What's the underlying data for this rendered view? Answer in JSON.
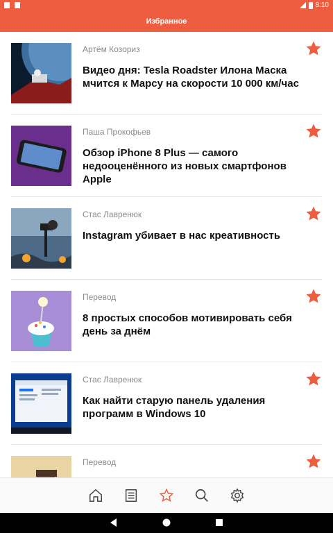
{
  "status_bar": {
    "time": "8:10"
  },
  "app_bar": {
    "title": "Избранное"
  },
  "articles": [
    {
      "author": "Артём Козориз",
      "title": "Видео дня: Tesla Roadster Илона Маска мчится к Марсу на скорости 10 000 км/час"
    },
    {
      "author": "Паша Прокофьев",
      "title": "Обзор iPhone 8 Plus — самого недооценённого из новых смартфонов Apple"
    },
    {
      "author": "Стас Лавренюк",
      "title": "Instagram убивает в нас креативность"
    },
    {
      "author": "Перевод",
      "title": "8 простых способов мотивировать себя день за днём"
    },
    {
      "author": "Стас Лавренюк",
      "title": "Как найти старую панель удаления программ в Windows 10"
    },
    {
      "author": "Перевод",
      "title": ""
    }
  ],
  "colors": {
    "accent": "#ee5d3f",
    "star": "#ee5d3f",
    "nav_active": "#ee5d3f"
  },
  "bottom_nav": [
    "home-icon",
    "article-list-icon",
    "star-icon",
    "search-icon",
    "gear-icon"
  ],
  "system_nav": [
    "back-icon",
    "home-circle-icon",
    "recents-icon"
  ]
}
